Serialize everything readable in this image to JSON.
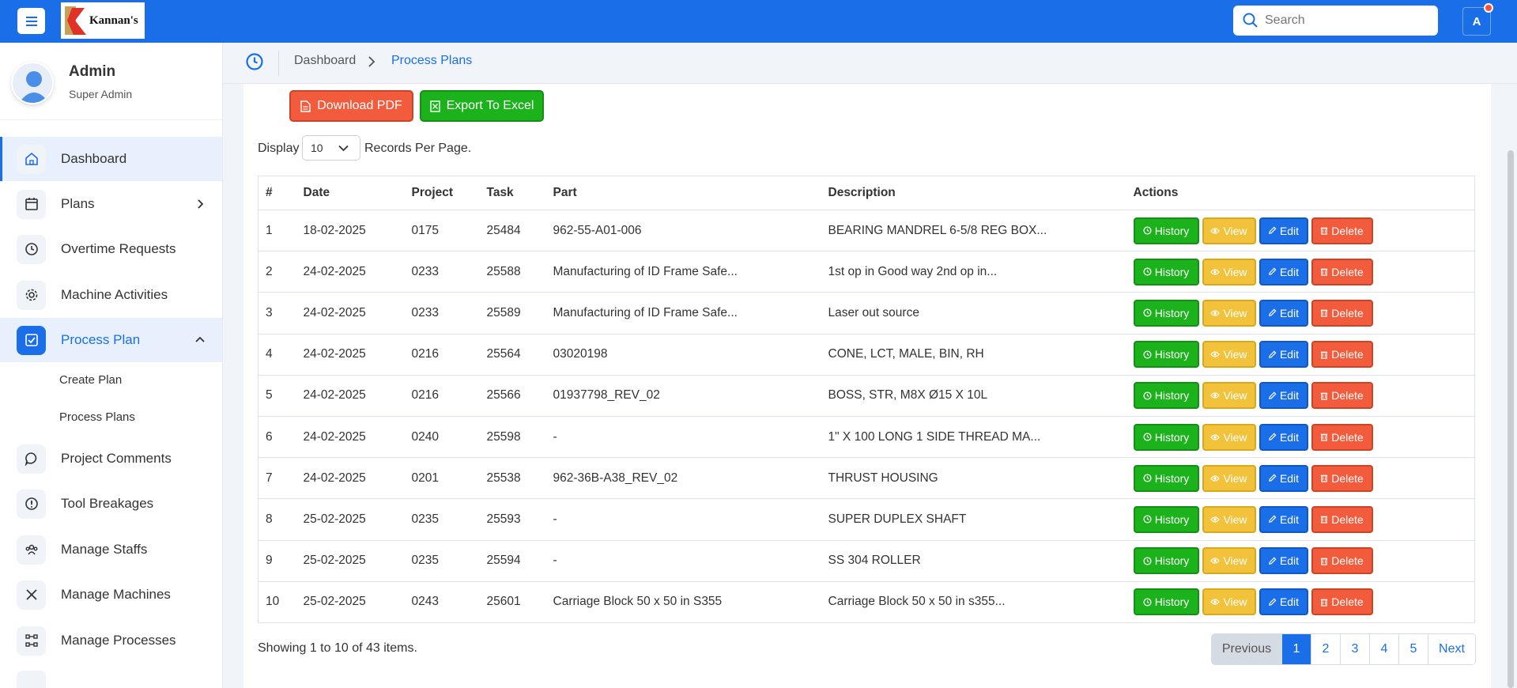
{
  "header": {
    "logo_text": "Kannan's",
    "search_placeholder": "Search",
    "avatar_initial": "A"
  },
  "profile": {
    "name": "Admin",
    "role": "Super Admin"
  },
  "sidebar": {
    "items": [
      {
        "label": "Dashboard",
        "icon": "home-icon"
      },
      {
        "label": "Plans",
        "icon": "calendar-icon"
      },
      {
        "label": "Overtime Requests",
        "icon": "clock-icon"
      },
      {
        "label": "Machine Activities",
        "icon": "gear-icon"
      },
      {
        "label": "Process Plan",
        "icon": "checkbox-icon"
      },
      {
        "label": "Project Comments",
        "icon": "chat-icon"
      },
      {
        "label": "Tool Breakages",
        "icon": "alert-icon"
      },
      {
        "label": "Manage Staffs",
        "icon": "users-icon"
      },
      {
        "label": "Manage Machines",
        "icon": "tools-icon"
      },
      {
        "label": "Manage Processes",
        "icon": "process-icon"
      }
    ],
    "subitems": [
      "Create Plan",
      "Process Plans"
    ]
  },
  "breadcrumb": {
    "home": "Dashboard",
    "current": "Process Plans"
  },
  "toolbar": {
    "pdf_label": "Download PDF",
    "excel_label": "Export To Excel"
  },
  "paging": {
    "display_label": "Display",
    "per_page": "10",
    "records_label": "Records Per Page."
  },
  "table": {
    "headers": [
      "#",
      "Date",
      "Project",
      "Task",
      "Part",
      "Description",
      "Actions"
    ],
    "action_labels": {
      "history": "History",
      "view": "View",
      "edit": "Edit",
      "delete": "Delete"
    },
    "rows": [
      {
        "num": "1",
        "date": "18-02-2025",
        "project": "0175",
        "task": "25484",
        "part": "962-55-A01-006",
        "description": "BEARING MANDREL 6-5/8 REG BOX..."
      },
      {
        "num": "2",
        "date": "24-02-2025",
        "project": "0233",
        "task": "25588",
        "part": "Manufacturing of ID Frame Safe...",
        "description": "1st op in Good way 2nd op in..."
      },
      {
        "num": "3",
        "date": "24-02-2025",
        "project": "0233",
        "task": "25589",
        "part": "Manufacturing of ID Frame Safe...",
        "description": "Laser out source"
      },
      {
        "num": "4",
        "date": "24-02-2025",
        "project": "0216",
        "task": "25564",
        "part": "03020198",
        "description": "CONE, LCT, MALE, BIN, RH"
      },
      {
        "num": "5",
        "date": "24-02-2025",
        "project": "0216",
        "task": "25566",
        "part": "01937798_REV_02",
        "description": "BOSS, STR, M8X Ø15 X 10L"
      },
      {
        "num": "6",
        "date": "24-02-2025",
        "project": "0240",
        "task": "25598",
        "part": "-",
        "description": "1\" X 100 LONG 1 SIDE THREAD MA..."
      },
      {
        "num": "7",
        "date": "24-02-2025",
        "project": "0201",
        "task": "25538",
        "part": "962-36B-A38_REV_02",
        "description": "THRUST HOUSING"
      },
      {
        "num": "8",
        "date": "25-02-2025",
        "project": "0235",
        "task": "25593",
        "part": "-",
        "description": "SUPER DUPLEX SHAFT"
      },
      {
        "num": "9",
        "date": "25-02-2025",
        "project": "0235",
        "task": "25594",
        "part": "-",
        "description": "SS 304 ROLLER"
      },
      {
        "num": "10",
        "date": "25-02-2025",
        "project": "0243",
        "task": "25601",
        "part": "Carriage Block 50 x 50 in S355",
        "description": "Carriage Block 50 x 50 in s355..."
      }
    ]
  },
  "footer": {
    "showing": "Showing 1 to 10 of 43 items.",
    "pagination": {
      "previous": "Previous",
      "pages": [
        "1",
        "2",
        "3",
        "4",
        "5"
      ],
      "next": "Next",
      "active": "1"
    }
  }
}
